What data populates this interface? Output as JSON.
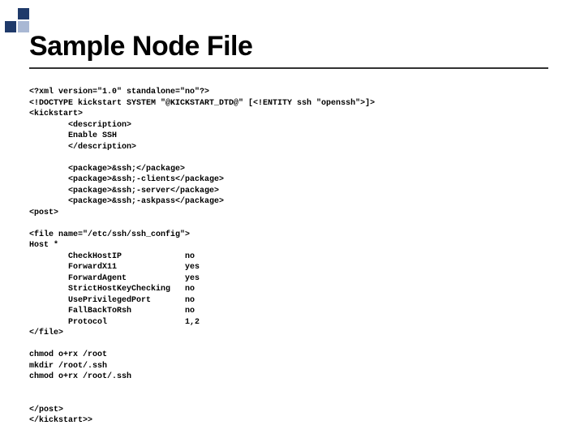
{
  "title": "Sample Node File",
  "code": "<?xml version=\"1.0\" standalone=\"no\"?>\n<!DOCTYPE kickstart SYSTEM \"@KICKSTART_DTD@\" [<!ENTITY ssh \"openssh\">]>\n<kickstart>\n        <description>\n        Enable SSH\n        </description>\n\n        <package>&ssh;</package>\n        <package>&ssh;-clients</package>\n        <package>&ssh;-server</package>\n        <package>&ssh;-askpass</package>\n<post>\n\n<file name=\"/etc/ssh/ssh_config\">\nHost *\n        CheckHostIP             no\n        ForwardX11              yes\n        ForwardAgent            yes\n        StrictHostKeyChecking   no\n        UsePrivilegedPort       no\n        FallBackToRsh           no\n        Protocol                1,2\n</file>\n\nchmod o+rx /root\nmkdir /root/.ssh\nchmod o+rx /root/.ssh\n\n\n</post>\n</kickstart>>"
}
